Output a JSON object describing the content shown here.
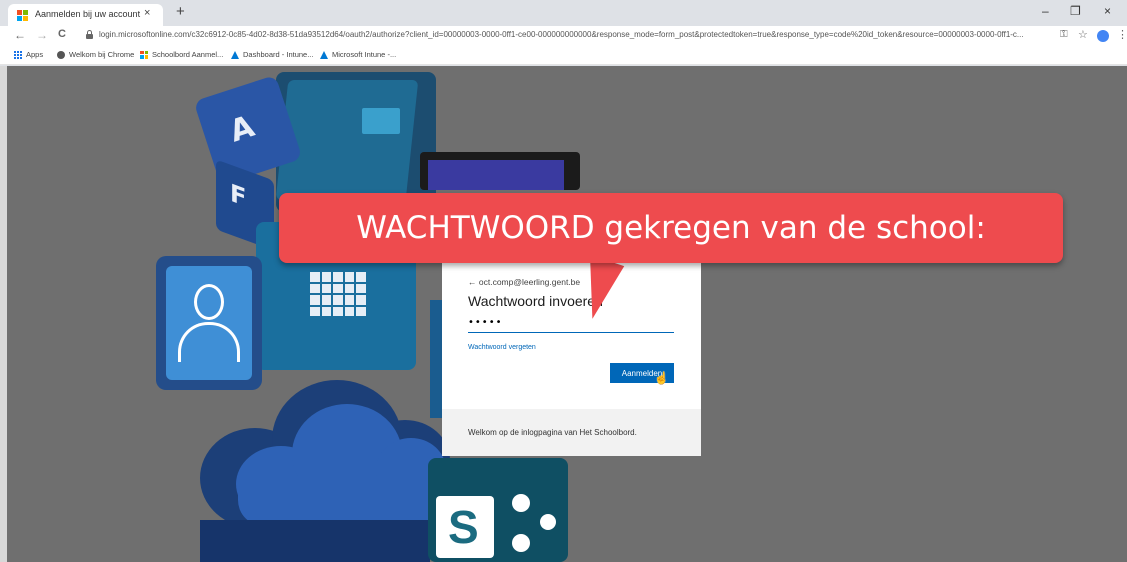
{
  "browser": {
    "tab": {
      "title": "Aanmelden bij uw account",
      "close": "×",
      "favicon": "microsoft-logo-icon"
    },
    "new_tab": "+",
    "window_controls": {
      "minimize": "–",
      "restore": "❐",
      "close": "×"
    },
    "nav": {
      "back": "←",
      "forward": "→",
      "reload": "C"
    },
    "url": "login.microsoftonline.com/c32c6912-0c85-4d02-8d38-51da93512d64/oauth2/authorize?client_id=00000003-0000-0ff1-ce00-000000000000&response_mode=form_post&protectedtoken=true&response_type=code%20id_token&resource=00000003-0000-0ff1-c...",
    "toolbar_icons": {
      "key": "⚿",
      "star": "☆",
      "menu": "⋮"
    }
  },
  "bookmarks": [
    {
      "label": "Apps",
      "icon": "apps-grid-icon"
    },
    {
      "label": "Welkom bij Chrome",
      "icon": "chrome-globe-icon"
    },
    {
      "label": "Schoolbord Aanmel...",
      "icon": "microsoft-logo-icon"
    },
    {
      "label": "Dashboard - Intune...",
      "icon": "azure-icon"
    },
    {
      "label": "Microsoft Intune -...",
      "icon": "azure-icon"
    }
  ],
  "background_art": {
    "dice_letters": [
      "A",
      "F"
    ],
    "sharepoint_letter": "S"
  },
  "login": {
    "back_arrow": "←",
    "email": "oct.comp@leerling.gent.be",
    "title": "Wachtwoord invoeren",
    "password_value": "•••••",
    "forgot_link": "Wachtwoord vergeten",
    "signin_button": "Aanmelden",
    "footer": "Welkom op de inlogpagina van Het Schoolbord."
  },
  "callout": {
    "text": "WACHTWOORD gekregen van de school:",
    "color": "#ee4b4e"
  },
  "colors": {
    "ms_blue": "#0067b8",
    "page_bg": "#6f6f6f"
  }
}
